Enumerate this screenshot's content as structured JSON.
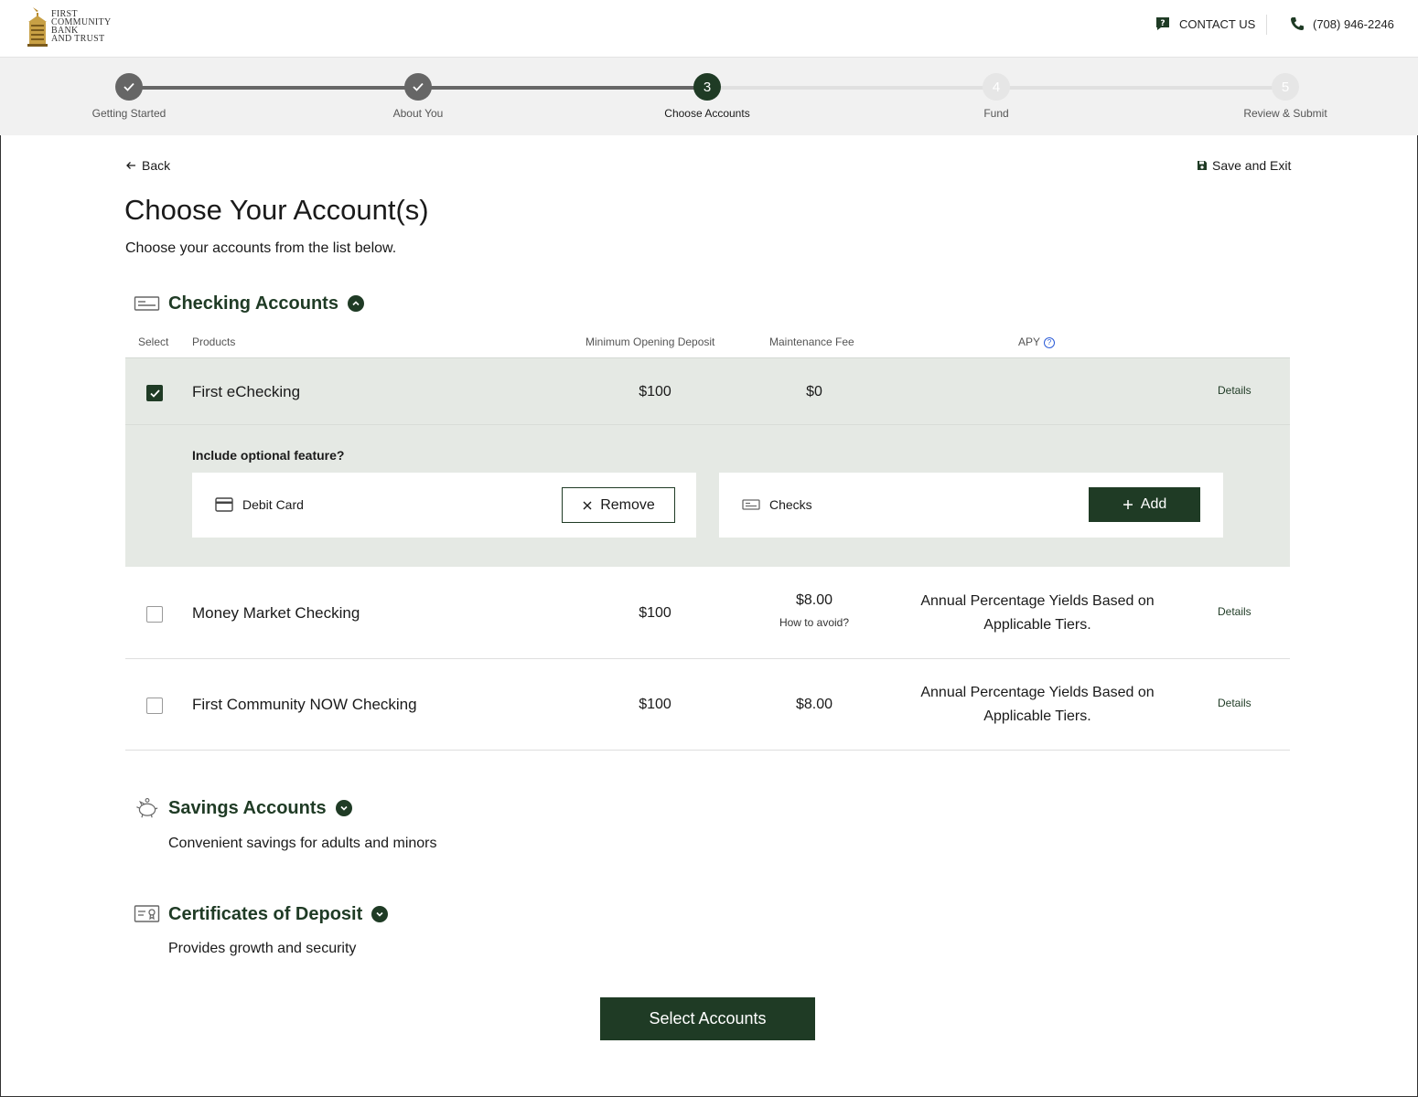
{
  "header": {
    "logo_lines": [
      "FIRST",
      "COMMUNITY",
      "BANK",
      "AND TRUST"
    ],
    "contact_label": "CONTACT US",
    "phone": "(708) 946-2246"
  },
  "stepper": {
    "steps": [
      {
        "number": "1",
        "label": "Getting Started",
        "state": "done"
      },
      {
        "number": "2",
        "label": "About You",
        "state": "done"
      },
      {
        "number": "3",
        "label": "Choose Accounts",
        "state": "current"
      },
      {
        "number": "4",
        "label": "Fund",
        "state": "todo"
      },
      {
        "number": "5",
        "label": "Review & Submit",
        "state": "todo"
      }
    ]
  },
  "nav": {
    "back_label": "Back",
    "save_exit_label": "Save and Exit"
  },
  "page": {
    "title": "Choose Your Account(s)",
    "subtitle": "Choose your accounts from the list below."
  },
  "checking": {
    "title": "Checking Accounts",
    "expanded": true,
    "columns": {
      "select": "Select",
      "products": "Products",
      "min_deposit": "Minimum Opening Deposit",
      "maint_fee": "Maintenance Fee",
      "apy": "APY"
    },
    "rows": [
      {
        "name": "First eChecking",
        "min_deposit": "$100",
        "maint_fee": "$0",
        "fee_note": "",
        "apy": "",
        "details": "Details",
        "selected": true
      },
      {
        "name": "Money Market Checking",
        "min_deposit": "$100",
        "maint_fee": "$8.00",
        "fee_note": "How to avoid?",
        "apy": "Annual Percentage Yields Based on Applicable Tiers.",
        "details": "Details",
        "selected": false
      },
      {
        "name": "First Community NOW Checking",
        "min_deposit": "$100",
        "maint_fee": "$8.00",
        "fee_note": "",
        "apy": "Annual Percentage Yields Based on Applicable Tiers.",
        "details": "Details",
        "selected": false
      }
    ],
    "optional": {
      "label": "Include optional feature?",
      "features": [
        {
          "name": "Debit Card",
          "action": "Remove",
          "action_icon": "close-icon"
        },
        {
          "name": "Checks",
          "action": "Add",
          "action_icon": "plus-icon"
        }
      ]
    }
  },
  "savings": {
    "title": "Savings Accounts",
    "description": "Convenient savings for adults and minors",
    "expanded": false
  },
  "cds": {
    "title": "Certificates of Deposit",
    "description": "Provides growth and security",
    "expanded": false
  },
  "footer": {
    "select_button": "Select Accounts"
  },
  "colors": {
    "brand_green": "#1f3b25",
    "selected_row_bg": "#e5e9e4",
    "stepper_bg": "#f1f1f1",
    "link_blue": "#2a5bd7"
  }
}
